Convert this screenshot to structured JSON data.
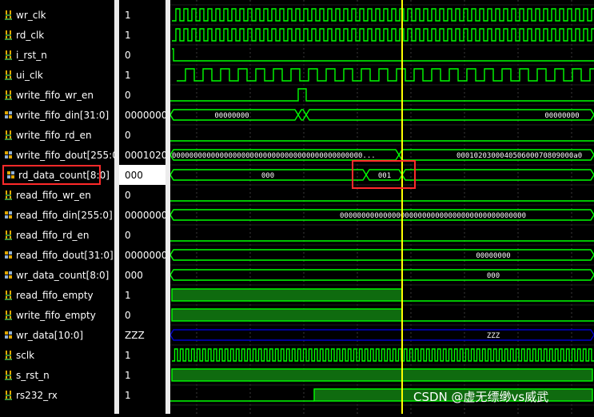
{
  "colors": {
    "signal": "#00ff00",
    "fill": "#0f6b0f",
    "cursor": "#ffff00",
    "bus_z": "#0000cc",
    "highlight_box": "#ff2a2a"
  },
  "signals": [
    {
      "name": "wr_clk",
      "value": "1",
      "icon": "bit-signal-icon"
    },
    {
      "name": "rd_clk",
      "value": "1",
      "icon": "bit-signal-icon"
    },
    {
      "name": "i_rst_n",
      "value": "0",
      "icon": "bit-signal-icon"
    },
    {
      "name": "ui_clk",
      "value": "1",
      "icon": "bit-signal-icon"
    },
    {
      "name": "write_fifo_wr_en",
      "value": "0",
      "icon": "bit-signal-icon"
    },
    {
      "name": "write_fifo_din[31:0]",
      "value": "00000000",
      "icon": "bus-signal-icon"
    },
    {
      "name": "write_fifo_rd_en",
      "value": "0",
      "icon": "bit-signal-icon"
    },
    {
      "name": "write_fifo_dout[255:0]",
      "value": "00010203",
      "icon": "bus-signal-icon"
    },
    {
      "name": "rd_data_count[8:0]",
      "value": "000",
      "icon": "bus-signal-icon"
    },
    {
      "name": "read_fifo_wr_en",
      "value": "0",
      "icon": "bit-signal-icon"
    },
    {
      "name": "read_fifo_din[255:0]",
      "value": "00000000",
      "icon": "bus-signal-icon"
    },
    {
      "name": "read_fifo_rd_en",
      "value": "0",
      "icon": "bit-signal-icon"
    },
    {
      "name": "read_fifo_dout[31:0]",
      "value": "00000000",
      "icon": "bus-signal-icon"
    },
    {
      "name": "wr_data_count[8:0]",
      "value": "000",
      "icon": "bus-signal-icon"
    },
    {
      "name": "read_fifo_empty",
      "value": "1",
      "icon": "bit-signal-icon"
    },
    {
      "name": "write_fifo_empty",
      "value": "0",
      "icon": "bit-signal-icon"
    },
    {
      "name": "wr_data[10:0]",
      "value": "ZZZ",
      "icon": "bus-signal-icon"
    },
    {
      "name": "sclk",
      "value": "1",
      "icon": "bit-signal-icon"
    },
    {
      "name": "s_rst_n",
      "value": "1",
      "icon": "bit-signal-icon"
    },
    {
      "name": "rs232_rx",
      "value": "1",
      "icon": "bit-signal-icon"
    }
  ],
  "wave_labels": {
    "write_fifo_din_a": "00000000",
    "write_fifo_din_b": "00000000",
    "write_fifo_dout_a": "00000000000000000000000000000000000000000000...",
    "write_fifo_dout_b": "000102030004050600070809000a0",
    "rd_data_count_a": "000",
    "rd_data_count_b": "001",
    "read_fifo_din": "0000000000000000000000000000000000000000000",
    "read_fifo_dout": "00000000",
    "wr_data_count": "000",
    "wr_data": "ZZZ"
  },
  "watermark": "CSDN @虚无缥缈vs威武"
}
